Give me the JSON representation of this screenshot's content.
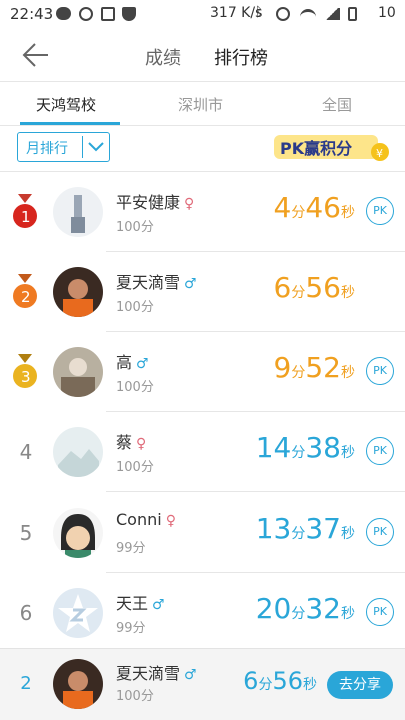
{
  "status_bar": {
    "time": "22:43",
    "speed": "317 K/s",
    "battery": "10",
    "icons": [
      "chat-icon",
      "sync-icon",
      "image-icon",
      "shield-icon",
      "bluetooth-icon",
      "alarm-icon",
      "wifi-icon",
      "signal-icon",
      "battery-icon"
    ]
  },
  "nav": {
    "tabs": [
      {
        "label": "成绩"
      },
      {
        "label": "排行榜"
      }
    ]
  },
  "region_tabs": [
    {
      "label": "天鸿驾校"
    },
    {
      "label": "深圳市"
    },
    {
      "label": "全国"
    }
  ],
  "filter": {
    "label": "月排行"
  },
  "pk_logo": {
    "text": "PK赢积分"
  },
  "labels": {
    "pk": "PK",
    "min": "分",
    "sec": "秒"
  },
  "rows": [
    {
      "rank": "1",
      "name": "平安健康",
      "gender": "♀",
      "score": "100分",
      "min": "4",
      "sec": "46",
      "time_color": "orange",
      "has_pk": true
    },
    {
      "rank": "2",
      "name": "夏天滴雪",
      "gender": "♂",
      "score": "100分",
      "min": "6",
      "sec": "56",
      "time_color": "orange",
      "has_pk": false
    },
    {
      "rank": "3",
      "name": "高",
      "gender": "♂",
      "score": "100分",
      "min": "9",
      "sec": "52",
      "time_color": "orange",
      "has_pk": true
    },
    {
      "rank": "4",
      "name": "蔡",
      "gender": "♀",
      "score": "100分",
      "min": "14",
      "sec": "38",
      "time_color": "blue",
      "has_pk": true
    },
    {
      "rank": "5",
      "name": "Conni",
      "gender": "♀",
      "score": "99分",
      "min": "13",
      "sec": "37",
      "time_color": "blue",
      "has_pk": true
    },
    {
      "rank": "6",
      "name": "天王",
      "gender": "♂",
      "score": "99分",
      "min": "20",
      "sec": "32",
      "time_color": "blue",
      "has_pk": true
    }
  ],
  "my_rank": {
    "rank": "2",
    "name": "夏天滴雪",
    "gender": "♂",
    "score": "100分",
    "min": "6",
    "sec": "56",
    "share_label": "去分享"
  },
  "colors": {
    "accent": "#2aa6d8",
    "orange": "#f0a020",
    "female": "#e06b7a"
  }
}
